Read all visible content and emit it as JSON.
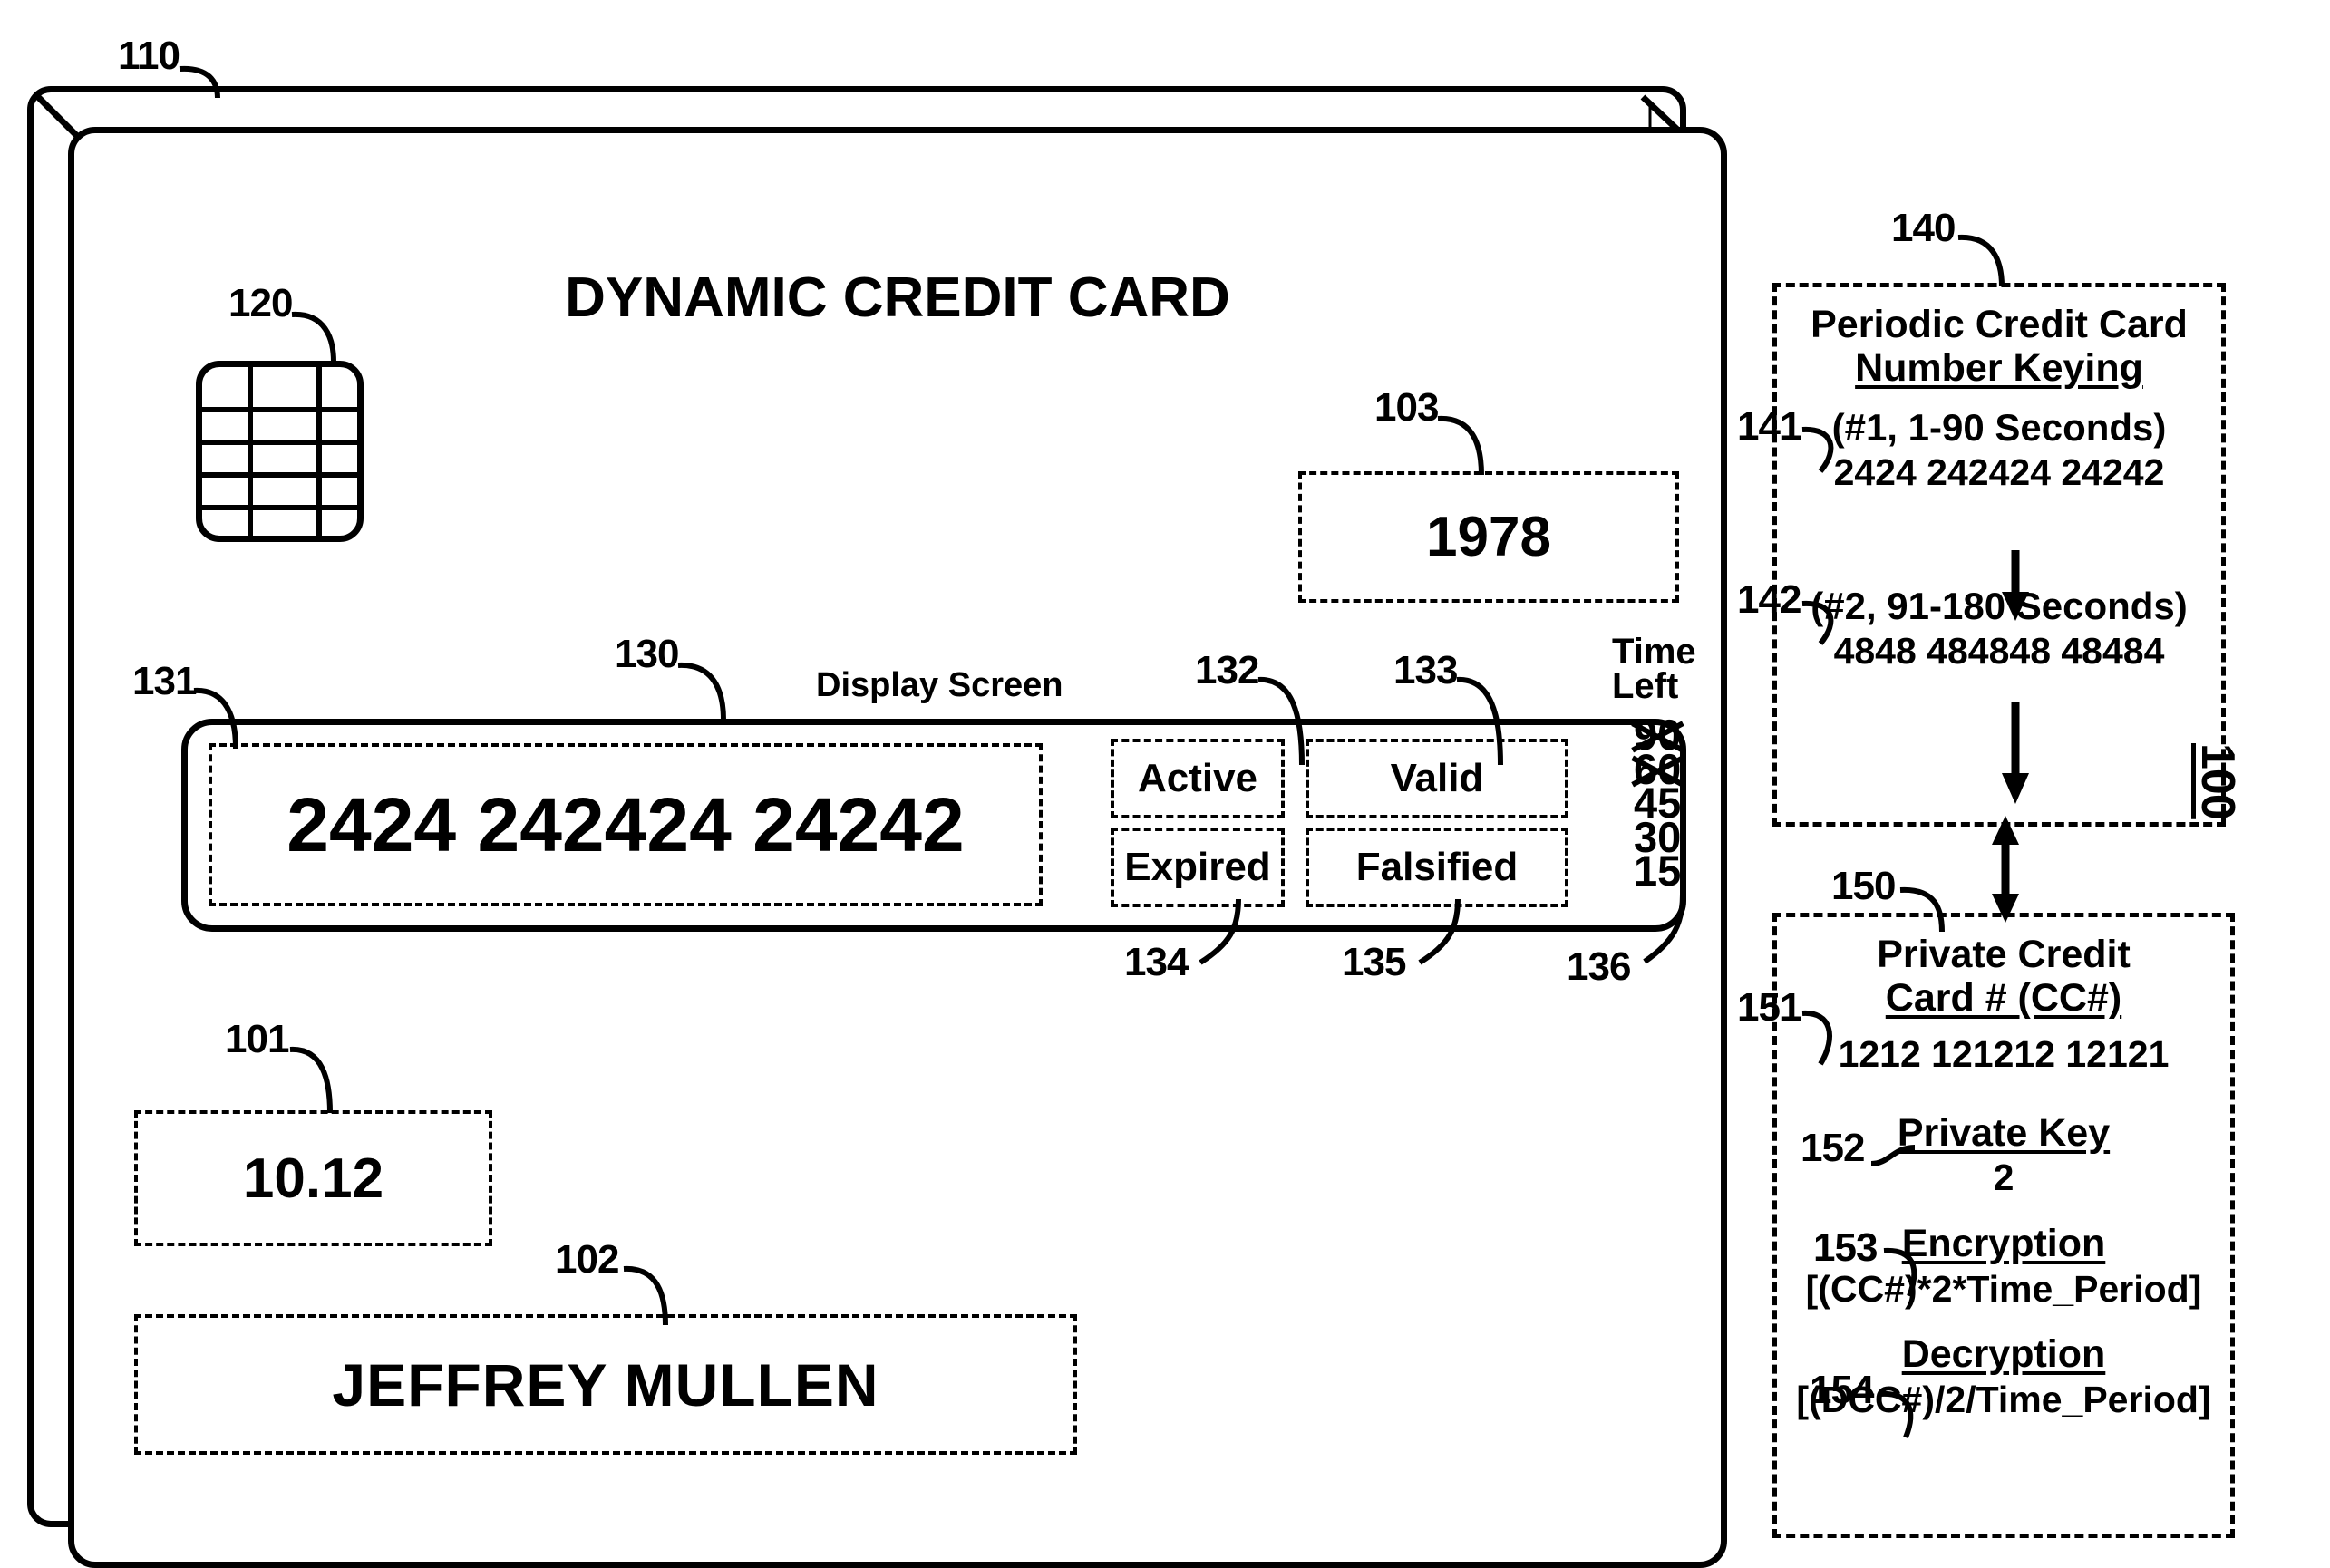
{
  "figure": {
    "number": "100",
    "card_ref": "110",
    "chip_ref": "120",
    "screen_ref": "130",
    "ccnum_ref": "131",
    "active_ref": "132",
    "valid_ref": "133",
    "expired_ref": "134",
    "falsified_ref": "135",
    "timeleft_ref": "136",
    "expiry_ref": "101",
    "name_ref": "102",
    "year_ref": "103",
    "panel140_ref": "140",
    "key1_ref": "141",
    "key2_ref": "142",
    "panel150_ref": "150",
    "ccnum150_ref": "151",
    "privatekey_ref": "152",
    "encryption_ref": "153",
    "decryption_ref": "154"
  },
  "card": {
    "title": "DYNAMIC CREDIT CARD",
    "screen_label": "Display Screen",
    "card_number": "2424  242424  24242",
    "year": "1978",
    "expiry": "10.12",
    "cardholder": "JEFFREY MULLEN",
    "status": {
      "active": "Active",
      "valid": "Valid",
      "expired": "Expired",
      "falsified": "Falsified"
    },
    "time_left": {
      "header_line1": "Time",
      "header_line2": "Left",
      "values": [
        "90",
        "60",
        "45",
        "30",
        "15"
      ],
      "struck": [
        true,
        true,
        false,
        false,
        false
      ]
    }
  },
  "panel_140": {
    "title_line1": "Periodic Credit Card",
    "title_line2": "Number Keying",
    "entries": [
      {
        "label": "(#1, 1-90 Seconds)",
        "number": "2424 242424 24242"
      },
      {
        "label": "(#2, 91-180 Seconds)",
        "number": "4848 484848 48484"
      }
    ]
  },
  "panel_150": {
    "title_line1": "Private Credit",
    "title_line2": "Card # (CC#)",
    "card_number": "1212 121212 12121",
    "private_key_label": "Private Key",
    "private_key_value": "2",
    "encryption_label": "Encryption",
    "encryption_formula": "[(CC#)*2*Time_Period]",
    "decryption_label": "Decryption",
    "decryption_formula": "[(DCC#)/2/Time_Period]"
  }
}
